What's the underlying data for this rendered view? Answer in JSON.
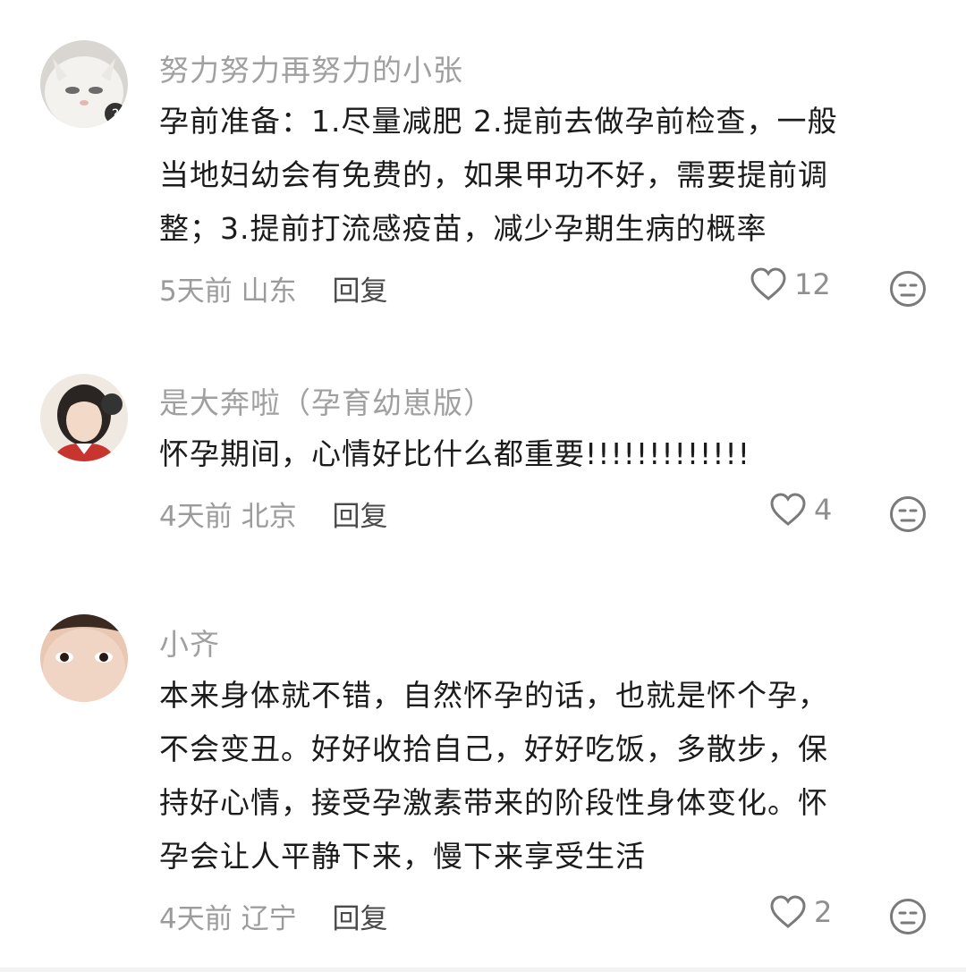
{
  "comments": [
    {
      "username": "努力努力再努力的小张",
      "avatar_icon": "cat-avatar-icon",
      "lines": [
        "孕前准备：1.尽量减肥 2.提前去做孕前检查，一般",
        "当地妇幼会有免费的，如果甲功不好，需要提前调",
        "整；3.提前打流感疫苗，减少孕期生病的概率"
      ],
      "time": "5天前",
      "location": "山东",
      "reply_label": "回复",
      "likes": "12"
    },
    {
      "username": "是大奔啦（孕育幼崽版）",
      "avatar_icon": "woman-avatar-icon",
      "lines": [
        "怀孕期间，心情好比什么都重要!!!!!!!!!!!!!"
      ],
      "time": "4天前",
      "location": "北京",
      "reply_label": "回复",
      "likes": "4"
    },
    {
      "username": "小齐",
      "avatar_icon": "face-avatar-icon",
      "lines": [
        "本来身体就不错，自然怀孕的话，也就是怀个孕，",
        "不会变丑。好好收拾自己，好好吃饭，多散步，保",
        "持好心情，接受孕激素带来的阶段性身体变化。怀",
        "孕会让人平静下来，慢下来享受生活"
      ],
      "time": "4天前",
      "location": "辽宁",
      "reply_label": "回复",
      "likes": "2"
    }
  ],
  "icons": {
    "like": "heart-outline-icon",
    "dislike": "meh-face-icon"
  },
  "colors": {
    "username": "#a0a0a0",
    "text": "#1b1b1b",
    "meta": "#9b9b9b",
    "icon": "#7a7a7a"
  }
}
